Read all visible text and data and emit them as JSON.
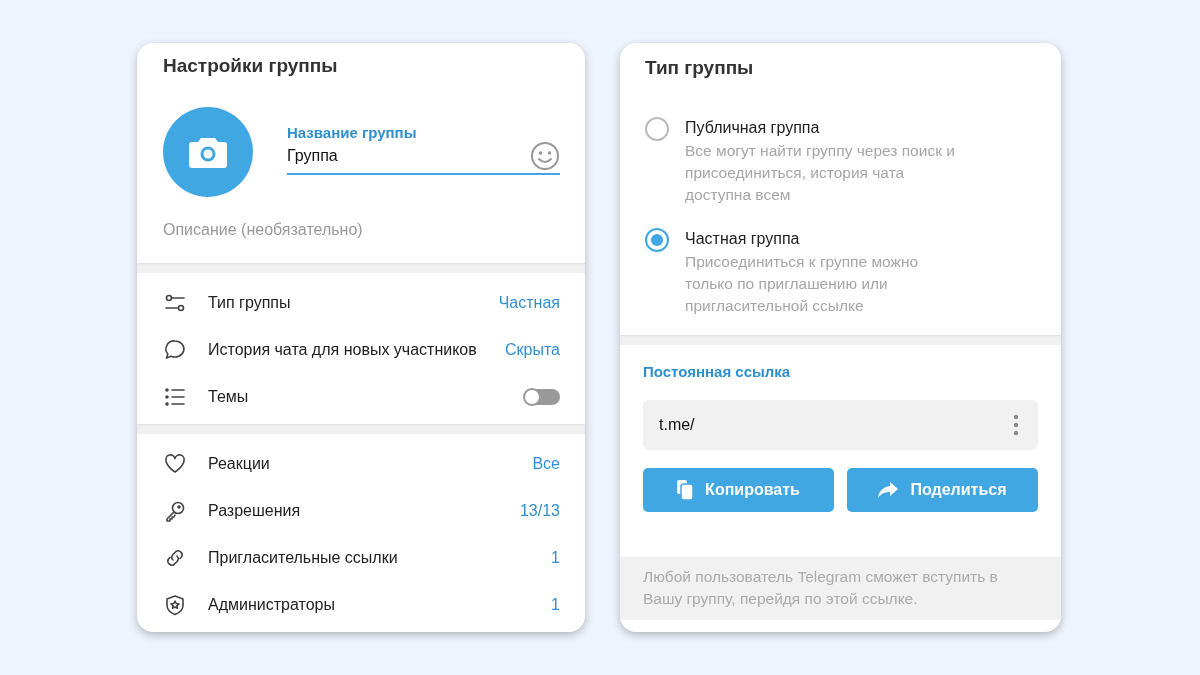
{
  "group_settings": {
    "title": "Настройки группы",
    "name_field": {
      "label": "Название группы",
      "value": "Группа"
    },
    "description": {
      "placeholder": "Описание (необязательно)"
    },
    "sections": [
      [
        {
          "kind": "value",
          "label": "Тип группы",
          "value": "Частная"
        },
        {
          "kind": "value",
          "label": "История чата для новых участников",
          "value": "Скрыта"
        },
        {
          "kind": "toggle",
          "label": "Темы",
          "on": false
        }
      ],
      [
        {
          "kind": "value",
          "label": "Реакции",
          "value": "Все"
        },
        {
          "kind": "value",
          "label": "Разрешения",
          "value": "13/13"
        },
        {
          "kind": "value",
          "label": "Пригласительные ссылки",
          "value": "1"
        },
        {
          "kind": "value",
          "label": "Администраторы",
          "value": "1"
        }
      ]
    ]
  },
  "group_type": {
    "title": "Тип группы",
    "options": [
      {
        "label": "Публичная группа",
        "description": "Все могут найти группу через поиск и присоединиться, история чата доступна всем",
        "selected": false
      },
      {
        "label": "Частная группа",
        "description": "Присоединиться к группе можно только по приглашению или пригласительной ссылке",
        "selected": true
      }
    ],
    "link": {
      "title": "Постоянная ссылка",
      "value": "t.me/",
      "buttons": [
        "Копировать",
        "Поделиться"
      ]
    },
    "note": "Любой пользователь Telegram сможет вступить в Вашу группу, перейдя по этой ссылке."
  }
}
